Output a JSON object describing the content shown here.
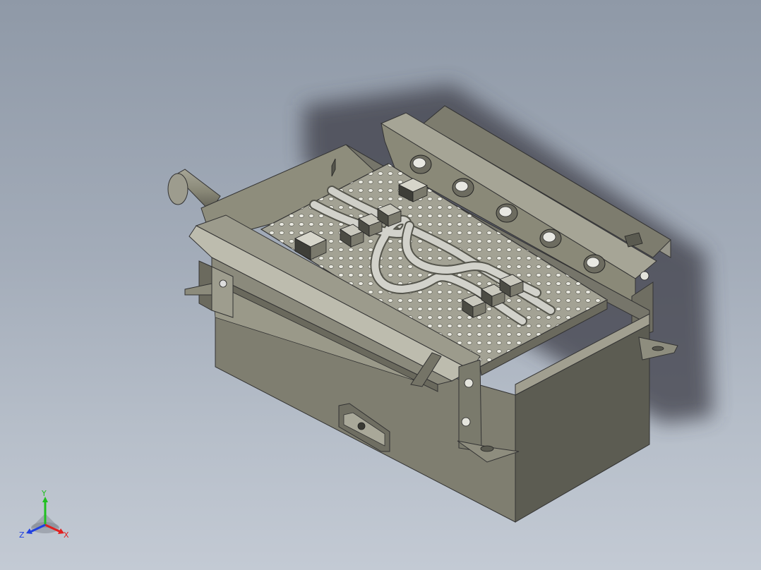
{
  "viewport": {
    "background_top": "#8f99a7",
    "background_bottom": "#c3cad4"
  },
  "model": {
    "body_color": "#8a8876",
    "body_dark": "#55554c",
    "body_light": "#b8b7a6",
    "plate_color": "#a6a596",
    "hole_color": "#f0f0ea",
    "tube_color": "#c8c8c0"
  },
  "triad": {
    "x_label": "X",
    "y_label": "Y",
    "z_label": "Z",
    "x_color": "#e02020",
    "y_color": "#20c020",
    "z_color": "#2040e0"
  }
}
